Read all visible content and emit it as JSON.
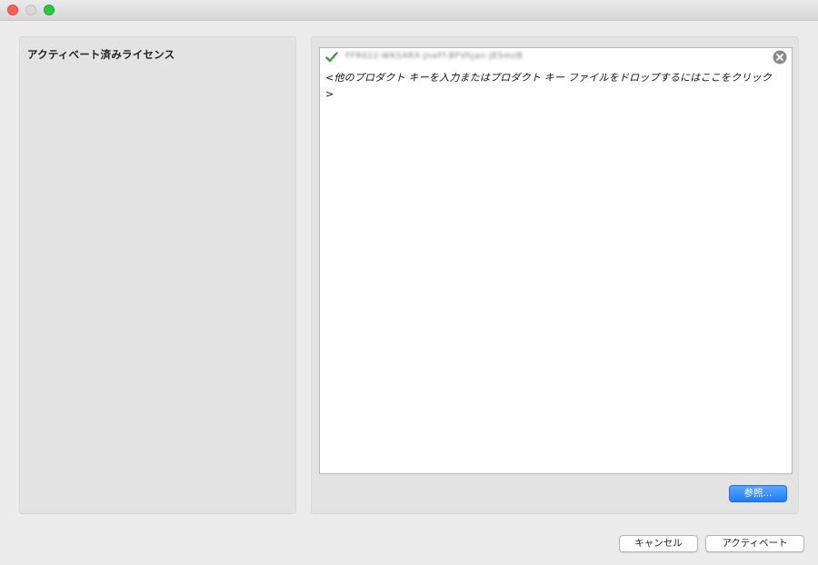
{
  "window": {
    "controls": [
      "close",
      "minimize",
      "zoom"
    ]
  },
  "left_panel": {
    "heading": "アクティベート済みライセンス"
  },
  "right_panel": {
    "key_entry": {
      "icon": "check-icon",
      "key_text": "FFR022-WKSARX-JneFf-BFVhjan-JESmzB",
      "remove_icon": "remove-icon"
    },
    "prompt_text": "<他のプロダクト キーを入力またはプロダクト キー ファイルをドロップするにはここをクリック\n>",
    "browse_label": "参照..."
  },
  "footer": {
    "cancel_label": "キャンセル",
    "activate_label": "アクティベート"
  },
  "colors": {
    "check": "#3c9a45",
    "accent_button": "#1f7cf5"
  }
}
